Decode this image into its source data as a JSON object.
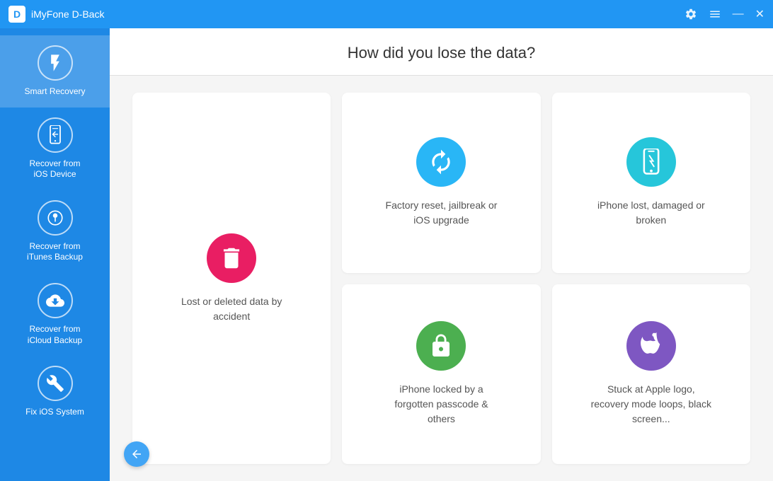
{
  "titlebar": {
    "logo": "D",
    "title": "iMyFone D-Back",
    "controls": [
      "settings",
      "menu",
      "minimize",
      "close"
    ]
  },
  "sidebar": {
    "items": [
      {
        "id": "smart-recovery",
        "label": "Smart Recovery",
        "icon": "⚡",
        "active": true
      },
      {
        "id": "recover-ios",
        "label": "Recover from\niOS Device",
        "icon": "📱",
        "active": false
      },
      {
        "id": "recover-itunes",
        "label": "Recover from\niTunes Backup",
        "icon": "♪",
        "active": false
      },
      {
        "id": "recover-icloud",
        "label": "Recover from\niCloud Backup",
        "icon": "↓",
        "active": false
      },
      {
        "id": "fix-ios",
        "label": "Fix iOS System",
        "icon": "🔧",
        "active": false
      }
    ]
  },
  "content": {
    "question": "How did you lose the data?",
    "cards": [
      {
        "id": "lost-deleted",
        "label": "Lost or deleted data by\naccident",
        "icon": "🗑",
        "color": "#E91E63",
        "size": "large"
      },
      {
        "id": "factory-reset",
        "label": "Factory reset, jailbreak or\niOS upgrade",
        "icon": "↺",
        "color": "#29B6F6",
        "size": "normal"
      },
      {
        "id": "iphone-lost",
        "label": "iPhone lost, damaged or\nbroken",
        "icon": "📱",
        "color": "#26C6DA",
        "size": "normal"
      },
      {
        "id": "iphone-locked",
        "label": "iPhone locked by a\nforgotten passcode &\nothers",
        "icon": "🔒",
        "color": "#4CAF50",
        "size": "normal"
      },
      {
        "id": "stuck-apple",
        "label": "Stuck at Apple logo,\nrecovery mode loops, black\nscreen...",
        "icon": "",
        "color": "#7E57C2",
        "size": "normal"
      }
    ],
    "back_button": "←"
  }
}
